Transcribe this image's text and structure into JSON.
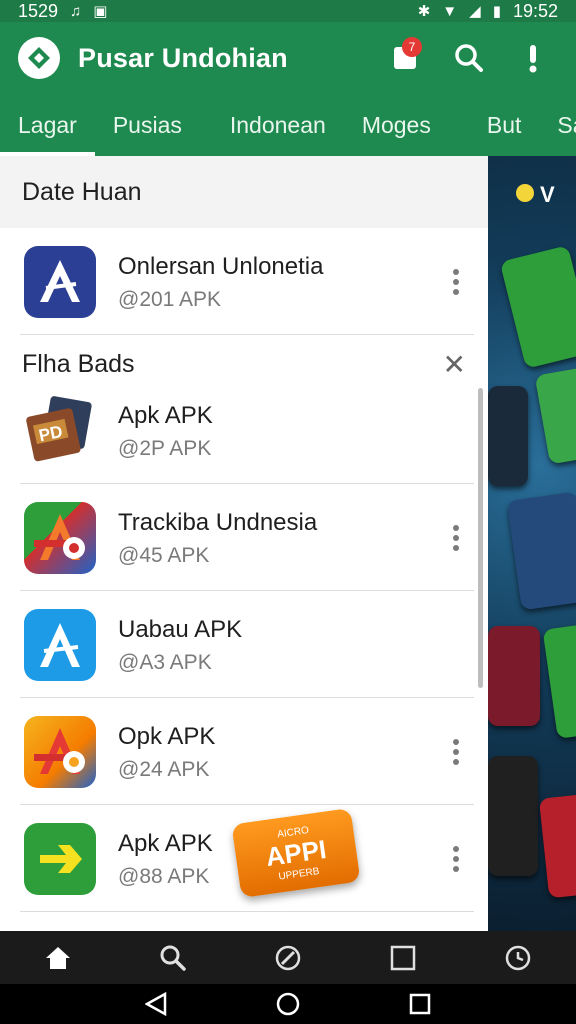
{
  "status_bar": {
    "time_left": "1529",
    "time_right": "19:52",
    "icons": [
      "music-icon",
      "image-icon",
      "bluetooth-icon",
      "wifi-icon",
      "signal-icon",
      "battery-icon"
    ]
  },
  "app_bar": {
    "title": "Pusar Undohian",
    "notification_count": "7",
    "actions": [
      "notification-icon",
      "search-icon",
      "info-icon"
    ]
  },
  "tabs": [
    "Lagar",
    "Pusias",
    "Indonean",
    "Moges",
    "But",
    "Sact"
  ],
  "active_tab": "Lagar",
  "sections": [
    {
      "header": "Date Huan",
      "items": [
        {
          "title": "Onlersan Unlonetia",
          "subtitle": "@201 APK",
          "icon": "store-icon",
          "icon_color": "#2b3f94"
        }
      ]
    },
    {
      "header": "Flha Bads",
      "items": [
        {
          "title": "Apk APK",
          "subtitle": "@2P APK",
          "icon": "pd-cards-icon",
          "icon_color": "#8a4a2a"
        },
        {
          "title": "Trackiba Undnesia",
          "subtitle": "@45 APK",
          "icon": "red-store-icon",
          "icon_color": "#d32f2f"
        },
        {
          "title": "Uabau APK",
          "subtitle": "@A3 APK",
          "icon": "blue-store-icon",
          "icon_color": "#2196f3"
        },
        {
          "title": "Opk APK",
          "subtitle": "@24 APK",
          "icon": "orange-store-icon",
          "icon_color": "#f57c00"
        },
        {
          "title": "Apk APK",
          "subtitle": "@88 APK",
          "icon": "arrow-icon",
          "icon_color": "#2e9e3a"
        }
      ]
    }
  ],
  "promo": {
    "label": "APPI",
    "small_top": "AICRO",
    "small_bottom": "UPPERB"
  },
  "side_panel": {
    "label": "V"
  },
  "bottom_nav": [
    "home-icon",
    "search-icon",
    "compass-icon",
    "square-icon",
    "clock-icon"
  ],
  "system_nav": [
    "back-icon",
    "home-circle-icon",
    "recents-icon"
  ],
  "colors": {
    "primary": "#1f8a4f",
    "status": "#1e7a47",
    "badge": "#e53935",
    "promo": "#ff9a1f"
  }
}
